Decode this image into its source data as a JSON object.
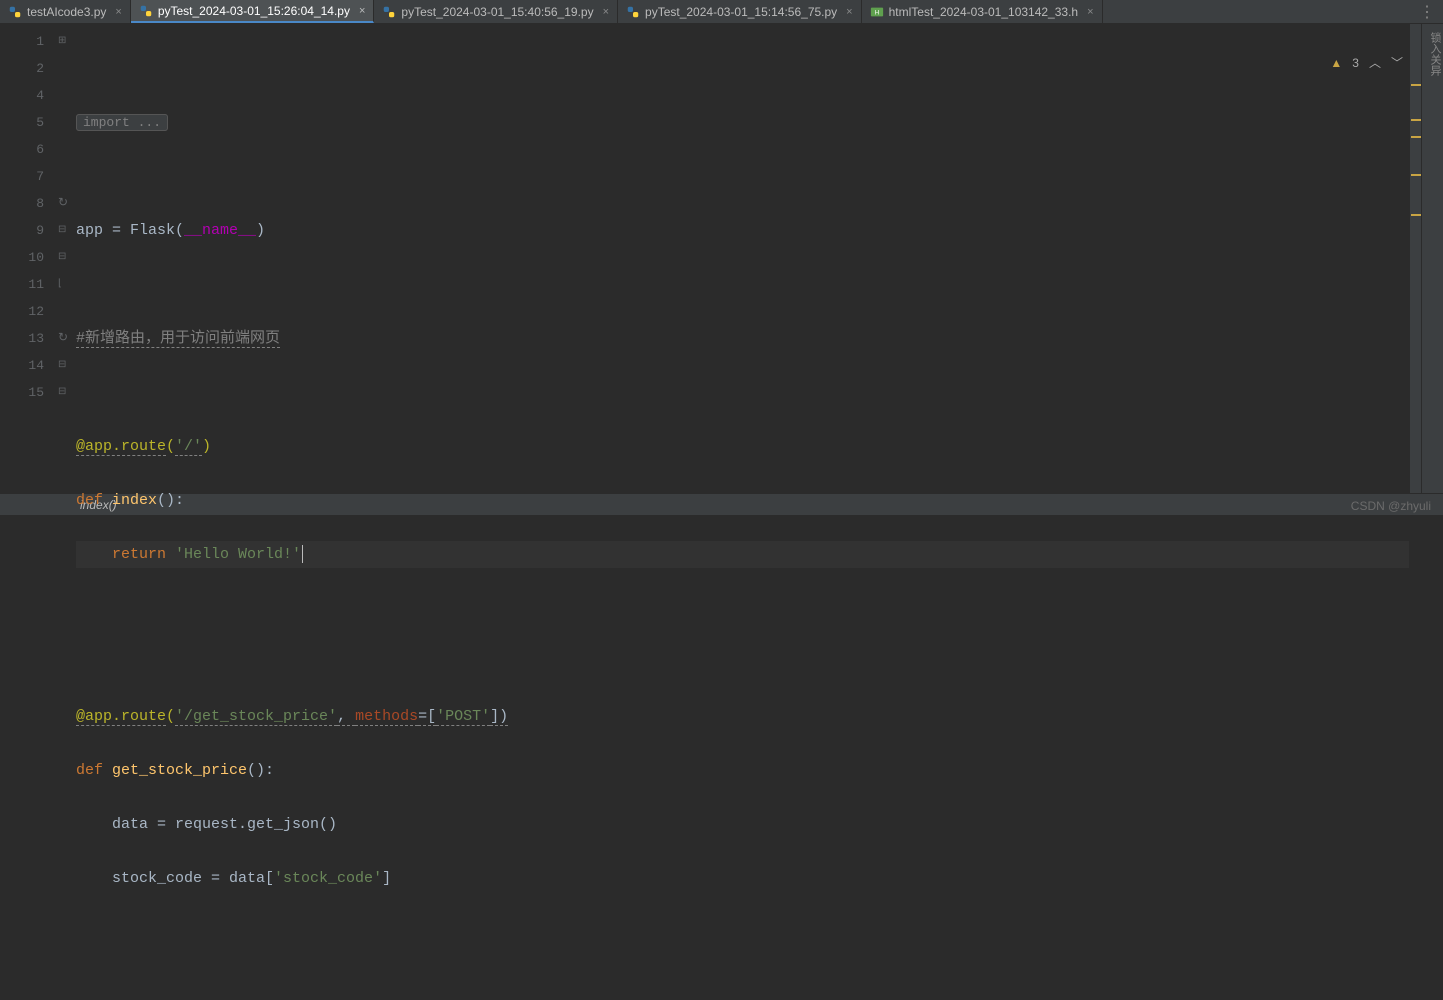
{
  "tabs": [
    {
      "label": "testAIcode3.py",
      "type": "py",
      "active": false
    },
    {
      "label": "pyTest_2024-03-01_15:26:04_14.py",
      "type": "py",
      "active": true
    },
    {
      "label": "pyTest_2024-03-01_15:40:56_19.py",
      "type": "py",
      "active": false
    },
    {
      "label": "pyTest_2024-03-01_15:14:56_75.py",
      "type": "py",
      "active": false
    },
    {
      "label": "htmlTest_2024-03-01_103142_33.h",
      "type": "html",
      "active": false
    }
  ],
  "gutter": {
    "lines": [
      "1",
      "2",
      "4",
      "5",
      "6",
      "7",
      "",
      "8",
      "9",
      "10",
      "11",
      "",
      "12",
      "13",
      "14",
      "15",
      ""
    ]
  },
  "code": {
    "l1_collapsed": "import ...",
    "l5_pre": "app = Flask(",
    "l5_dunder": "__name__",
    "l5_post": ")",
    "l7_comment": "#新增路由，用于访问前端网页",
    "l8_decor": "@app.route",
    "l8_args_open": "(",
    "l8_str": "'/'",
    "l8_args_close": ")",
    "l9_def": "def ",
    "l9_fn": "index",
    "l9_sig": "():",
    "l10_ret": "    return ",
    "l10_str": "'Hello World!'",
    "l12_decor": "@app.route",
    "l12_args_open": "(",
    "l12_str1": "'/get_stock_price'",
    "l12_sep": ", ",
    "l12_kw": "methods",
    "l12_eq": "=[",
    "l12_str2": "'POST'",
    "l12_close": "])",
    "l13_def": "def ",
    "l13_fn": "get_stock_price",
    "l13_sig": "():",
    "l14": "    data = request.get_json()",
    "l15_pre": "    stock_code = data[",
    "l15_str": "'stock_code'",
    "l15_post": "]"
  },
  "inspection": {
    "warn_count": "3"
  },
  "breadcrumb": {
    "text": "index()"
  },
  "sidebar_label": "锁入关异",
  "watermark": "CSDN @zhyuli"
}
